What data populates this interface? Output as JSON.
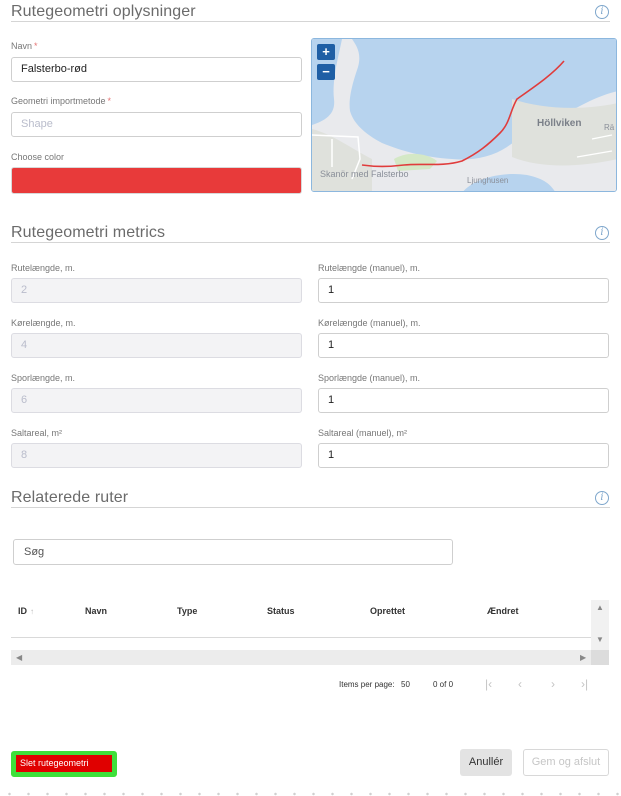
{
  "info": {
    "title": "Rutegeometri oplysninger",
    "name_label": "Navn",
    "name_value": "Falsterbo-rød",
    "import_label": "Geometri importmetode",
    "import_placeholder": "Shape",
    "color_label": "Choose color",
    "color_value": "#e83a3a",
    "required_mark": "*"
  },
  "map": {
    "zoom_in": "+",
    "zoom_out": "−",
    "labels": [
      "Höllviken",
      "Skanör med Falsterbo",
      "Ljunghusen",
      "Rä"
    ],
    "route_color": "#e03c3c",
    "water_color": "#b7d3ee",
    "land_color": "#e9eaed"
  },
  "metrics": {
    "title": "Rutegeometri metrics",
    "rows": [
      {
        "label": "Rutelængde, m.",
        "value": "2",
        "manual_label": "Rutelængde (manuel), m.",
        "manual_value": "1"
      },
      {
        "label": "Kørelængde, m.",
        "value": "4",
        "manual_label": "Kørelængde (manuel), m.",
        "manual_value": "1"
      },
      {
        "label": "Sporlængde, m.",
        "value": "6",
        "manual_label": "Sporlængde (manuel), m.",
        "manual_value": "1"
      },
      {
        "label": "Saltareal, m²",
        "value": "8",
        "manual_label": "Saltareal (manuel), m²",
        "manual_value": "1"
      }
    ]
  },
  "related": {
    "title": "Relaterede ruter",
    "search_placeholder": "Søg",
    "columns": [
      "ID",
      "Navn",
      "Type",
      "Status",
      "Oprettet",
      "Ændret"
    ],
    "sort_icon": "↑",
    "items_per_page_label": "Items per page:",
    "items_per_page": "50",
    "range": "0 of 0"
  },
  "footer": {
    "delete_label": "Slet rutegeometri",
    "cancel_label": "Anullér",
    "save_label": "Gem og afslut"
  }
}
